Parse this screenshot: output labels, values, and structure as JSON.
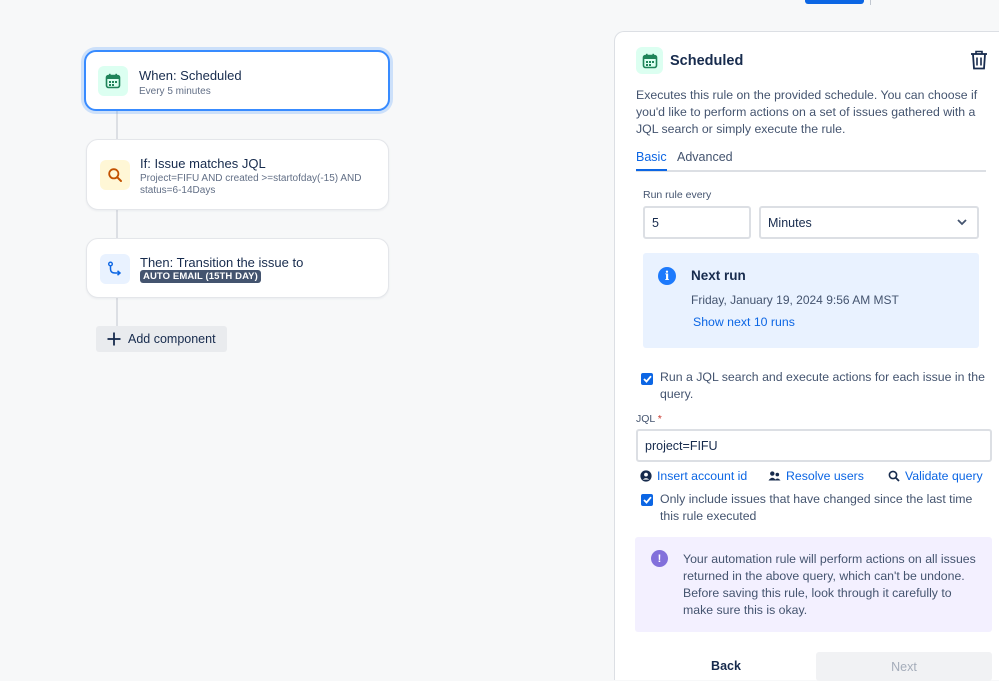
{
  "rule": {
    "trigger": {
      "title": "When: Scheduled",
      "subtitle": "Every 5 minutes",
      "icon": "calendar-icon"
    },
    "condition": {
      "title": "If: Issue matches JQL",
      "subtitle": "Project=FIFU AND created >=startofday(-15) AND status=6-14Days",
      "icon": "search-icon"
    },
    "action": {
      "title": "Then: Transition the issue to",
      "lozenge": "AUTO EMAIL (15TH DAY)",
      "icon": "transition-icon"
    },
    "add_component_label": "Add component"
  },
  "panel": {
    "title": "Scheduled",
    "description": "Executes this rule on the provided schedule. You can choose if you'd like to perform actions on a set of issues gathered with a JQL search or simply execute the rule.",
    "tabs": [
      {
        "label": "Basic",
        "active": true
      },
      {
        "label": "Advanced",
        "active": false
      }
    ],
    "run_rule_label": "Run rule every",
    "interval_value": "5",
    "interval_unit": "Minutes",
    "next_run": {
      "title": "Next run",
      "date": "Friday, January 19, 2024 9:56 AM MST",
      "link": "Show next 10 runs"
    },
    "jql_checkbox": {
      "label": "Run a JQL search and execute actions for each issue in the query.",
      "checked": true
    },
    "jql_label": "JQL",
    "jql_required_mark": "*",
    "jql_value": "project=FIFU",
    "links": {
      "insert_account": "Insert account id",
      "resolve_users": "Resolve users",
      "validate_query": "Validate query"
    },
    "changed_checkbox": {
      "label": "Only include issues that have changed since the last time this rule executed",
      "checked": true
    },
    "warning": "Your automation rule will perform actions on all issues returned in the above query, which can't be undone. Before saving this rule, look through it carefully to make sure this is okay.",
    "back_label": "Back",
    "next_label": "Next"
  },
  "colors": {
    "primary": "#0c66e4",
    "info_bg": "#e9f2ff",
    "warning_bg": "#f3f0ff",
    "discovery": "#8270db",
    "lozenge_bg": "#44546f"
  }
}
